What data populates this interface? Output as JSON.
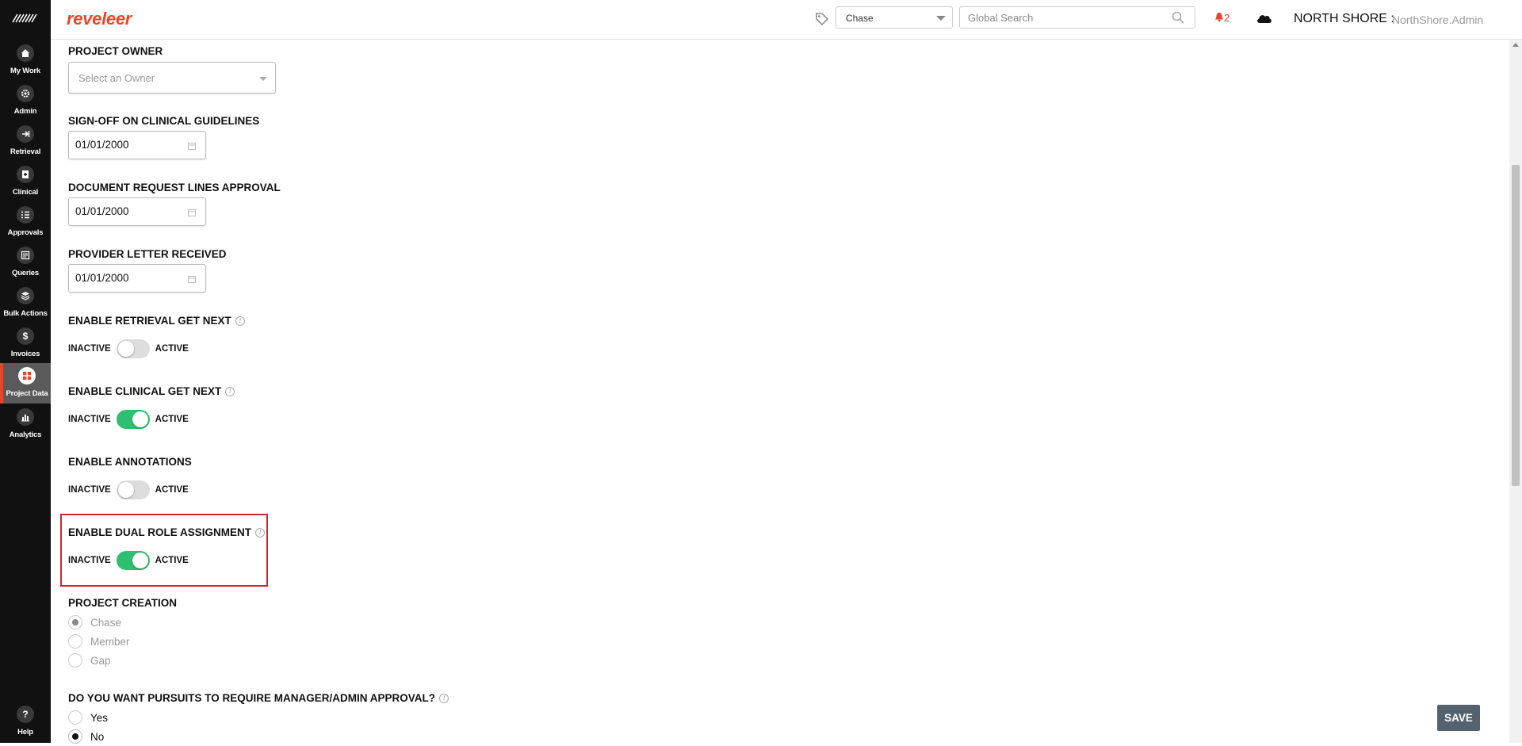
{
  "app": {
    "brand": "reveleer"
  },
  "sidenav": {
    "items": [
      {
        "label": "My Work",
        "icon": "home-icon"
      },
      {
        "label": "Admin",
        "icon": "gear-icon"
      },
      {
        "label": "Retrieval",
        "icon": "arrow-right-icon"
      },
      {
        "label": "Clinical",
        "icon": "clipboard-icon"
      },
      {
        "label": "Approvals",
        "icon": "list-icon"
      },
      {
        "label": "Queries",
        "icon": "document-icon"
      },
      {
        "label": "Bulk Actions",
        "icon": "layers-icon"
      },
      {
        "label": "Invoices",
        "icon": "dollar-icon"
      },
      {
        "label": "Project Data",
        "icon": "project-data-icon",
        "active": true
      },
      {
        "label": "Analytics",
        "icon": "bar-chart-icon"
      }
    ],
    "help": {
      "label": "Help",
      "glyph": "?"
    }
  },
  "topbar": {
    "chase_select": "Chase",
    "search_placeholder": "Global Search",
    "notification_count": "2",
    "org_name": "NORTH SHORE :",
    "user_name": "NorthShore.Admin"
  },
  "form": {
    "project_owner": {
      "label": "PROJECT OWNER",
      "placeholder": "Select an Owner"
    },
    "signoff": {
      "label": "SIGN-OFF ON CLINICAL GUIDELINES",
      "value": "01/01/2000"
    },
    "doc_request": {
      "label": "DOCUMENT REQUEST LINES APPROVAL",
      "value": "01/01/2000"
    },
    "provider_letter": {
      "label": "PROVIDER LETTER RECEIVED",
      "value": "01/01/2000"
    },
    "toggles": [
      {
        "label": "ENABLE RETRIEVAL GET NEXT",
        "info": true,
        "active": false
      },
      {
        "label": "ENABLE CLINICAL GET NEXT",
        "info": true,
        "active": true
      },
      {
        "label": "ENABLE ANNOTATIONS",
        "info": false,
        "active": false
      },
      {
        "label": "ENABLE DUAL ROLE ASSIGNMENT",
        "info": true,
        "active": true
      }
    ],
    "toggle_inactive_label": "INACTIVE",
    "toggle_active_label": "ACTIVE",
    "project_creation": {
      "label": "PROJECT CREATION",
      "options": [
        "Chase",
        "Member",
        "Gap"
      ],
      "selected": "Chase"
    },
    "pursuits": {
      "label": "DO YOU WANT PURSUITS TO REQUIRE MANAGER/ADMIN APPROVAL?",
      "options": [
        "Yes",
        "No"
      ],
      "selected": "No"
    },
    "save_label": "SAVE"
  },
  "colors": {
    "brand": "#e8462b",
    "toggle_on": "#2fbf71",
    "highlight": "#d9232e",
    "save_button": "#546270"
  }
}
